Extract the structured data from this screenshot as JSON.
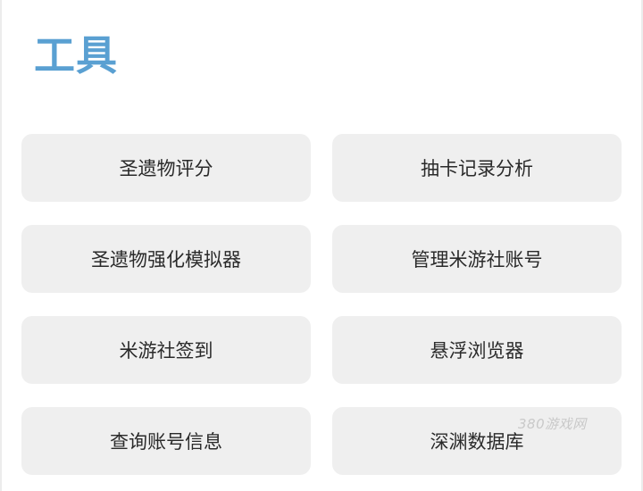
{
  "header": {
    "title": "工具"
  },
  "tools": [
    {
      "label": "圣遗物评分"
    },
    {
      "label": "抽卡记录分析"
    },
    {
      "label": "圣遗物强化模拟器"
    },
    {
      "label": "管理米游社账号"
    },
    {
      "label": "米游社签到"
    },
    {
      "label": "悬浮浏览器"
    },
    {
      "label": "查询账号信息"
    },
    {
      "label": "深渊数据库"
    }
  ],
  "watermark": {
    "text": "380游戏网"
  },
  "colors": {
    "title": "#5aa0d2",
    "button_bg": "#efefef",
    "button_text": "#2a2a2a",
    "background": "#ffffff"
  }
}
